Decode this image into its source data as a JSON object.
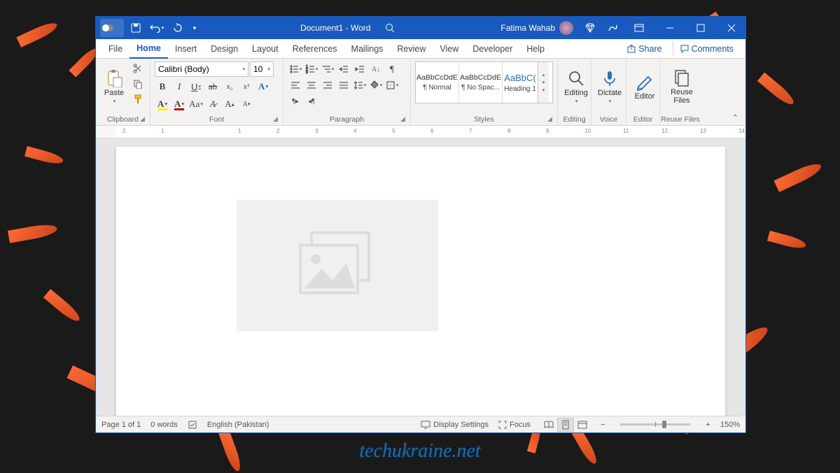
{
  "titlebar": {
    "document_title": "Document1  -  Word",
    "user_name": "Fatima Wahab"
  },
  "tabs": {
    "file": "File",
    "home": "Home",
    "insert": "Insert",
    "design": "Design",
    "layout": "Layout",
    "references": "References",
    "mailings": "Mailings",
    "review": "Review",
    "view": "View",
    "developer": "Developer",
    "help": "Help",
    "share": "Share",
    "comments": "Comments"
  },
  "ribbon": {
    "clipboard": {
      "paste": "Paste",
      "label": "Clipboard"
    },
    "font": {
      "label": "Font",
      "name": "Calibri (Body)",
      "size": "10",
      "bold": "B",
      "italic": "I",
      "underline": "U",
      "strike": "ab",
      "sub": "x₂",
      "sup": "x²"
    },
    "paragraph": {
      "label": "Paragraph"
    },
    "styles": {
      "label": "Styles",
      "items": [
        {
          "preview": "AaBbCcDdE",
          "name": "¶ Normal"
        },
        {
          "preview": "AaBbCcDdE",
          "name": "¶ No Spac..."
        },
        {
          "preview": "AaBbC(",
          "name": "Heading 1"
        }
      ]
    },
    "editing": {
      "label": "Editing",
      "btn": "Editing"
    },
    "voice": {
      "label": "Voice",
      "btn": "Dictate"
    },
    "editor": {
      "label": "Editor",
      "btn": "Editor"
    },
    "reuse": {
      "label": "Reuse Files",
      "btn": "Reuse Files"
    }
  },
  "statusbar": {
    "page": "Page 1 of 1",
    "words": "0 words",
    "language": "English (Pakistan)",
    "display": "Display Settings",
    "focus": "Focus",
    "zoom": "150%"
  },
  "watermark": "techukraine.net"
}
